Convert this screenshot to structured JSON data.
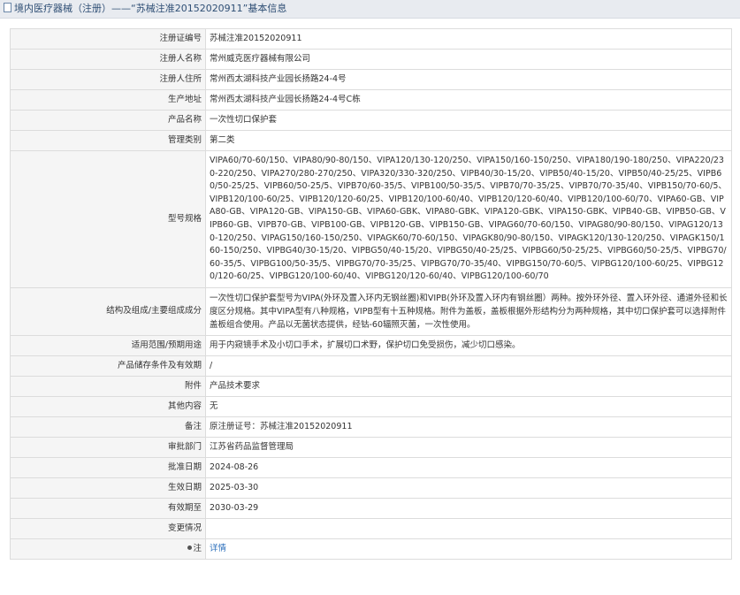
{
  "title": "境内医疗器械（注册）——“苏械注准20152020911”基本信息",
  "rows": [
    {
      "label": "注册证编号",
      "value": "苏械注准20152020911"
    },
    {
      "label": "注册人名称",
      "value": "常州威克医疗器械有限公司"
    },
    {
      "label": "注册人住所",
      "value": "常州西太湖科技产业园长扬路24-4号"
    },
    {
      "label": "生产地址",
      "value": "常州西太湖科技产业园长扬路24-4号C栋"
    },
    {
      "label": "产品名称",
      "value": "一次性切口保护套"
    },
    {
      "label": "管理类别",
      "value": "第二类"
    },
    {
      "label": "型号规格",
      "value": "VIPA60/70-60/150、VIPA80/90-80/150、VIPA120/130-120/250、VIPA150/160-150/250、VIPA180/190-180/250、VIPA220/230-220/250、VIPA270/280-270/250、VIPA320/330-320/250、VIPB40/30-15/20、VIPB50/40-15/20、VIPB50/40-25/25、VIPB60/50-25/25、VIPB60/50-25/5、VIPB70/60-35/5、VIPB100/50-35/5、VIPB70/70-35/25、VIPB70/70-35/40、VIPB150/70-60/5、VIPB120/100-60/25、VIPB120/120-60/25、VIPB120/100-60/40、VIPB120/120-60/40、VIPB120/100-60/70、VIPA60-GB、VIPA80-GB、VIPA120-GB、VIPA150-GB、VIPA60-GBK、VIPA80-GBK、VIPA120-GBK、VIPA150-GBK、VIPB40-GB、VIPB50-GB、VIPB60-GB、VIPB70-GB、VIPB100-GB、VIPB120-GB、VIPB150-GB、VIPAG60/70-60/150、VIPAG80/90-80/150、VIPAG120/130-120/250、VIPAG150/160-150/250、VIPAGK60/70-60/150、VIPAGK80/90-80/150、VIPAGK120/130-120/250、VIPAGK150/160-150/250、VIPBG40/30-15/20、VIPBG50/40-15/20、VIPBG50/40-25/25、VIPBG60/50-25/25、VIPBG60/50-25/5、VIPBG70/60-35/5、VIPBG100/50-35/5、VIPBG70/70-35/25、VIPBG70/70-35/40、VIPBG150/70-60/5、VIPBG120/100-60/25、VIPBG120/120-60/25、VIPBG120/100-60/40、VIPBG120/120-60/40、VIPBG120/100-60/70"
    },
    {
      "label": "结构及组成/主要组成成分",
      "value": "一次性切口保护套型号为VIPA(外环及置入环内无钢丝圈)和VIPB(外环及置入环内有钢丝圈）两种。按外环外径、置入环外径、通道外径和长度区分规格。其中VIPA型有八种规格，VIPB型有十五种规格。附件为盖板，盖板根据外形结构分为两种规格，其中切口保护套可以选择附件盖板组合使用。产品以无菌状态提供，经钴-60辐照灭菌，一次性使用。"
    },
    {
      "label": "适用范围/预期用途",
      "value": "用于内窥镜手术及小切口手术，扩展切口术野，保护切口免受损伤，减少切口感染。"
    },
    {
      "label": "产品储存条件及有效期",
      "value": "/"
    },
    {
      "label": "附件",
      "value": "产品技术要求"
    },
    {
      "label": "其他内容",
      "value": "无"
    },
    {
      "label": "备注",
      "value": "原注册证号：苏械注准20152020911"
    },
    {
      "label": "审批部门",
      "value": "江苏省药品监督管理局"
    },
    {
      "label": "批准日期",
      "value": "2024-08-26"
    },
    {
      "label": "生效日期",
      "value": "2025-03-30"
    },
    {
      "label": "有效期至",
      "value": "2030-03-29"
    },
    {
      "label": "变更情况",
      "value": ""
    }
  ],
  "note": {
    "label": "注",
    "link_text": "详情"
  }
}
